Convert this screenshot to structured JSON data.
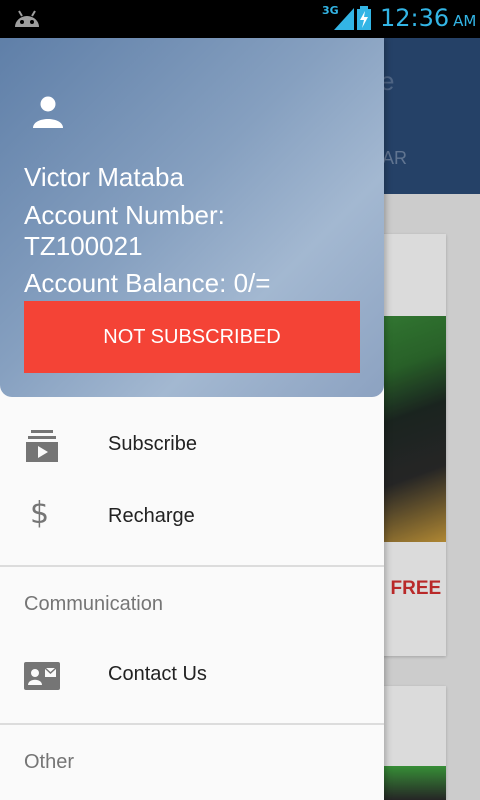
{
  "status_bar": {
    "network": "3G",
    "time": "12:36",
    "ampm": "AM",
    "accent_color": "#33b5e5",
    "icons": [
      "android-debug-icon",
      "signal-icon",
      "battery-charging-icon"
    ]
  },
  "background_app": {
    "toolbar_title_fragment": "e",
    "tab_fragment": "AR",
    "card_text_fragment": "I FREE"
  },
  "drawer": {
    "header": {
      "name": "Victor Mataba",
      "account_number_label": "Account Number:",
      "account_number": "TZ100021",
      "account_balance": "Account Balance: 0/=",
      "subscription_button": "NOT SUBSCRIBED",
      "button_color": "#f44336"
    },
    "items": [
      {
        "label": "Subscribe",
        "icon": "subscriptions-icon"
      },
      {
        "label": "Recharge",
        "icon": "dollar-icon"
      }
    ],
    "sections": [
      {
        "title": "Communication",
        "items": [
          {
            "label": "Contact Us",
            "icon": "contact-card-icon"
          }
        ]
      },
      {
        "title": "Other"
      }
    ]
  }
}
